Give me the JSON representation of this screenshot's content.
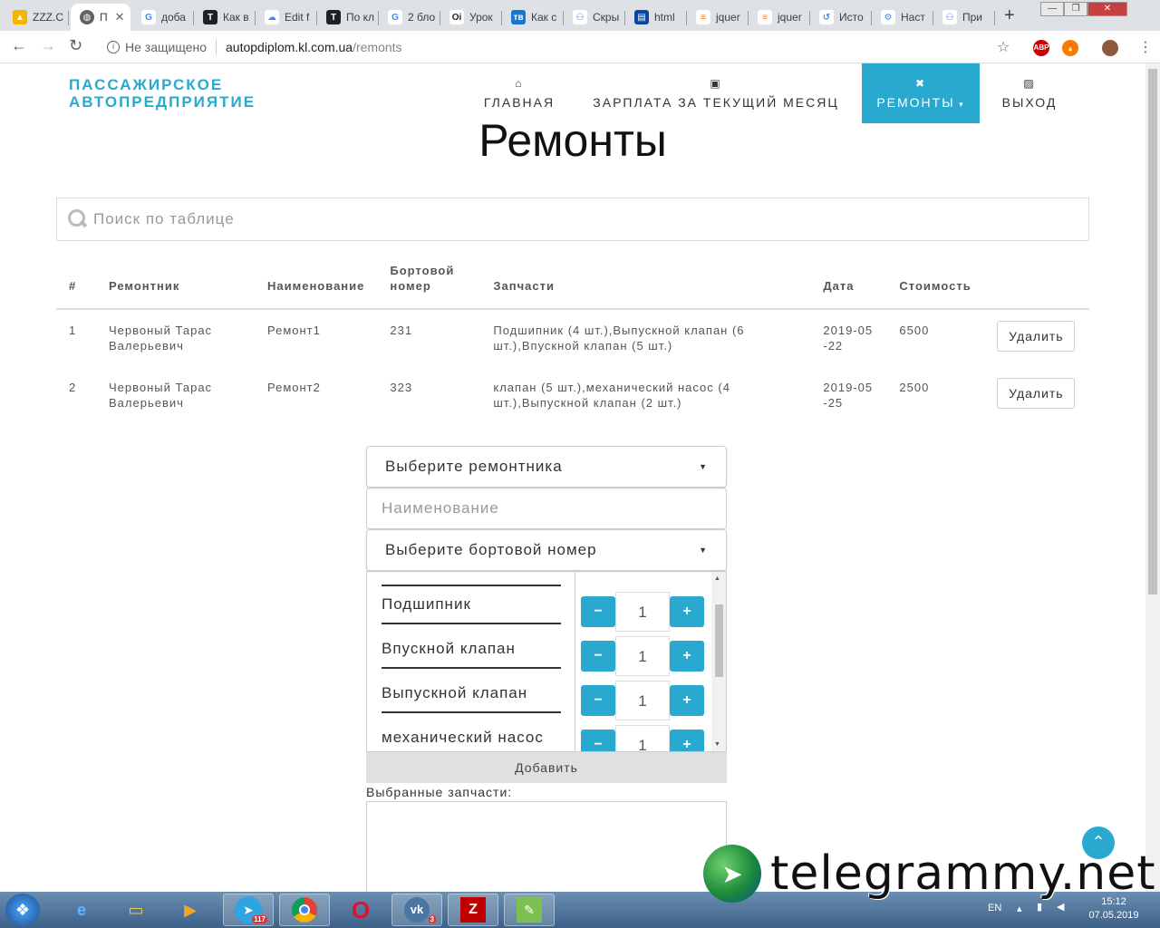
{
  "browser": {
    "tabs": [
      {
        "title": "ZZZ.С",
        "icon": "drive-icon",
        "color": "#f4b400"
      },
      {
        "title": "П",
        "icon": "globe-icon",
        "color": "#5f6368",
        "active": true
      },
      {
        "title": "доба",
        "icon": "google-icon",
        "color": "#4285f4"
      },
      {
        "title": "Как в",
        "icon": "t-icon",
        "color": "#202124"
      },
      {
        "title": "Edit f",
        "icon": "cloud-icon",
        "color": "#4285f4"
      },
      {
        "title": "По кл",
        "icon": "t-icon",
        "color": "#202124"
      },
      {
        "title": "2 бло",
        "icon": "google-icon",
        "color": "#4285f4"
      },
      {
        "title": "Урок",
        "icon": "oi-icon",
        "color": "#202124"
      },
      {
        "title": "Как с",
        "icon": "tb-icon",
        "color": "#1976d2"
      },
      {
        "title": "Скры",
        "icon": "nodes-icon",
        "color": "#4285f4"
      },
      {
        "title": "html",
        "icon": "book-icon",
        "color": "#0d47a1"
      },
      {
        "title": "jquer",
        "icon": "stack-icon",
        "color": "#f48024"
      },
      {
        "title": "jquer",
        "icon": "stack-icon",
        "color": "#f48024"
      },
      {
        "title": "Исто",
        "icon": "history-icon",
        "color": "#4285f4"
      },
      {
        "title": "Наст",
        "icon": "gear-icon",
        "color": "#4285f4"
      },
      {
        "title": "При",
        "icon": "nodes-icon",
        "color": "#4285f4"
      }
    ],
    "security_text": "Не защищено",
    "url_domain": "autopdiplom.kl.com.ua",
    "url_path": "/remonts",
    "ext_abp": "ABP"
  },
  "site": {
    "brand_line1": "ПАССАЖИРСКОЕ",
    "brand_line2": "АВТОПРЕДПРИЯТИЕ",
    "nav": [
      {
        "label": "ГЛАВНАЯ",
        "icon": "home-icon"
      },
      {
        "label": "ЗАРПЛАТА ЗА ТЕКУЩИЙ МЕСЯЦ",
        "icon": "money-icon"
      },
      {
        "label": "РЕМОНТЫ",
        "icon": "wrench-icon",
        "active": true
      },
      {
        "label": "ВЫХОД",
        "icon": "picture-icon"
      }
    ],
    "accent": "#29a9cf"
  },
  "page": {
    "title": "Ремонты",
    "search_placeholder": "Поиск по таблице"
  },
  "table": {
    "headers": [
      "#",
      "Ремонтник",
      "Наименование",
      "Бортовой номер",
      "Запчасти",
      "Дата",
      "Стоимость"
    ],
    "rows": [
      {
        "num": "1",
        "repairman": "Червоный Тарас Валерьевич",
        "name": "Ремонт1",
        "board": "231",
        "parts": "Подшипник (4 шт.),Выпускной клапан (6 шт.),Впускной клапан (5 шт.)",
        "date": "2019-05-22",
        "cost": "6500",
        "delete": "Удалить"
      },
      {
        "num": "2",
        "repairman": "Червоный Тарас Валерьевич",
        "name": "Ремонт2",
        "board": "323",
        "parts": "клапан (5 шт.),механический насос (4 шт.),Выпускной клапан (2 шт.)",
        "date": "2019-05-25",
        "cost": "2500",
        "delete": "Удалить"
      }
    ]
  },
  "form": {
    "repairman_select": "Выберите ремонтника",
    "name_placeholder": "Наименование",
    "board_select": "Выберите бортовой номер",
    "parts": [
      {
        "name": "Подшипник",
        "qty": "1"
      },
      {
        "name": "Впускной клапан",
        "qty": "1"
      },
      {
        "name": "Выпускной клапан",
        "qty": "1"
      },
      {
        "name": "механический насос",
        "qty": "1"
      }
    ],
    "minus": "−",
    "plus": "+",
    "add_button": "Добавить",
    "chosen_label": "Выбранные запчасти:"
  },
  "watermark": "telegrammy.net",
  "taskbar": {
    "apps": [
      {
        "icon": "ie-icon"
      },
      {
        "icon": "explorer-icon"
      },
      {
        "icon": "media-player-icon"
      },
      {
        "icon": "telegram-icon",
        "badge": "117"
      },
      {
        "icon": "chrome-icon"
      },
      {
        "icon": "opera-icon"
      },
      {
        "icon": "vk-icon",
        "badge": "3"
      },
      {
        "icon": "filezilla-icon"
      },
      {
        "icon": "notepad-icon"
      }
    ],
    "lang": "EN",
    "time": "15:12",
    "date": "07.05.2019"
  }
}
